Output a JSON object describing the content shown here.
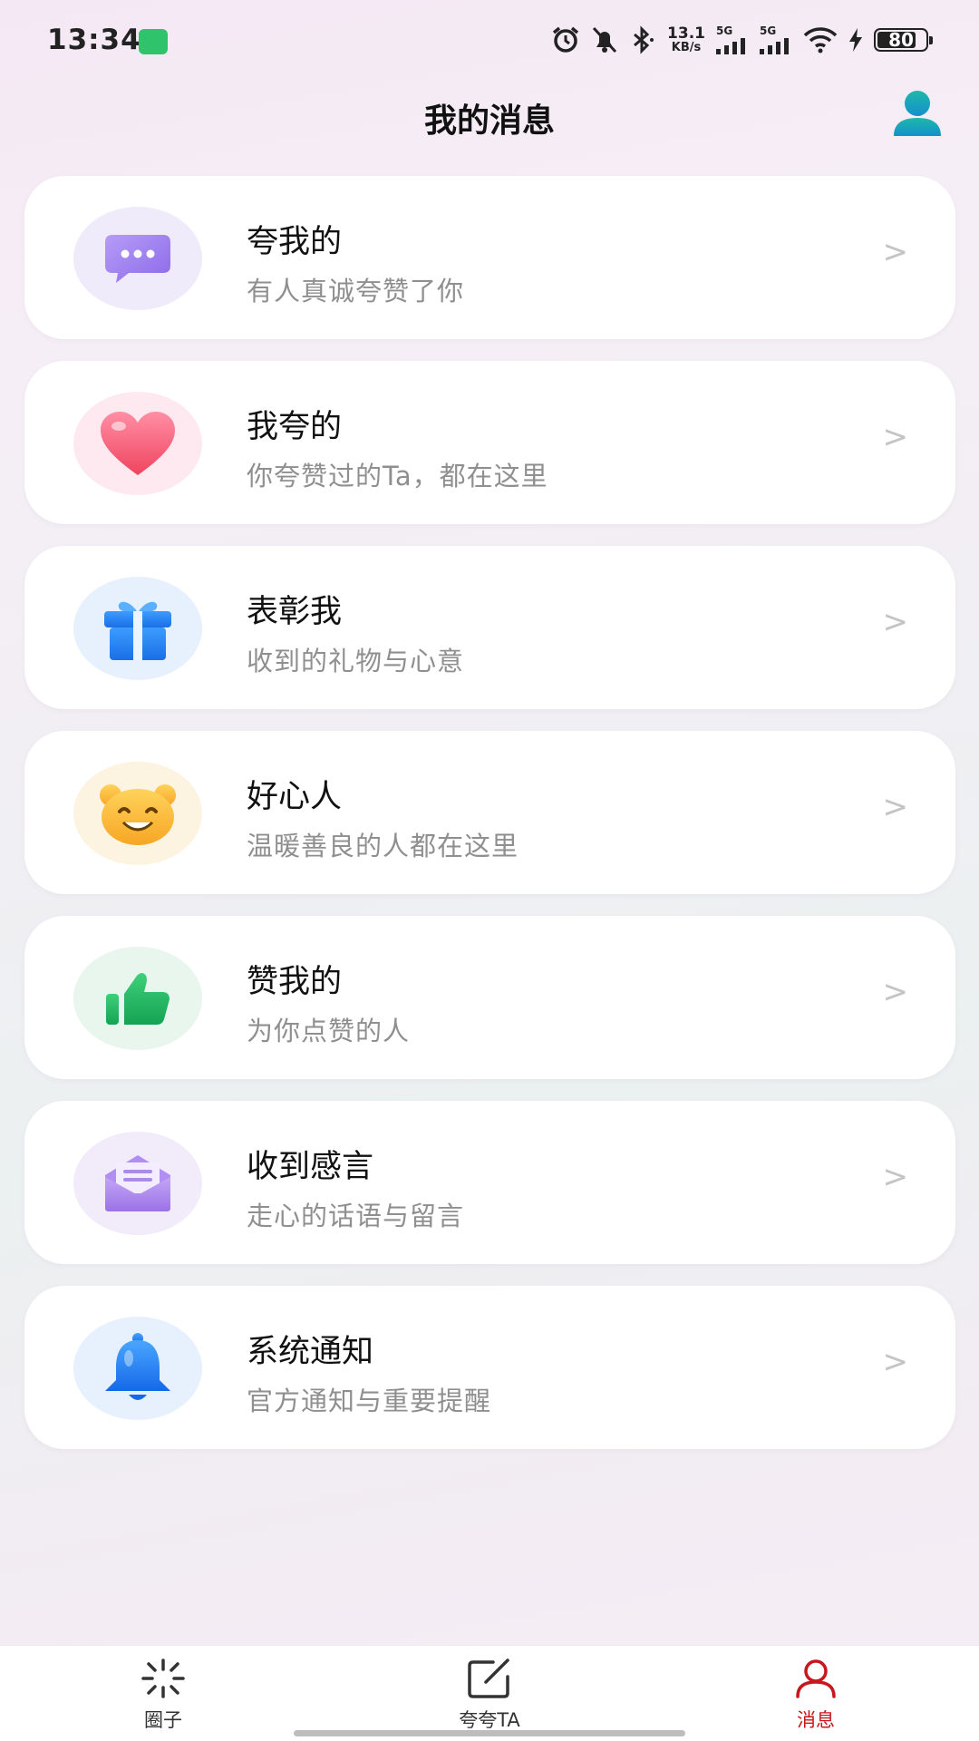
{
  "status_bar": {
    "time": "13:34",
    "net_speed_value": "13.1",
    "net_speed_unit": "KB/s",
    "signal1_label": "5G",
    "signal2_label": "5G",
    "battery": "80",
    "battery_level": 0.8
  },
  "header": {
    "title": "我的消息",
    "profile_icon": "user-silhouette-icon"
  },
  "items": [
    {
      "title": "夸我的",
      "subtitle": "有人真诚夸赞了你",
      "icon": "chat-bubble-icon",
      "bg": "#efebfb",
      "arrow": ">"
    },
    {
      "title": "我夸的",
      "subtitle": "你夸赞过的Ta，都在这里",
      "icon": "heart-icon",
      "bg": "#fde9ef",
      "arrow": ">"
    },
    {
      "title": "表彰我",
      "subtitle": "收到的礼物与心意",
      "icon": "gift-icon",
      "bg": "#e6f1fd",
      "arrow": ">"
    },
    {
      "title": "好心人",
      "subtitle": "温暖善良的人都在这里",
      "icon": "smiley-bear-icon",
      "bg": "#fdf3e1",
      "arrow": ">"
    },
    {
      "title": "赞我的",
      "subtitle": "为你点赞的人",
      "icon": "thumbs-up-icon",
      "bg": "#e8f6ee",
      "arrow": ">"
    },
    {
      "title": "收到感言",
      "subtitle": "走心的话语与留言",
      "icon": "envelope-icon",
      "bg": "#f1ebfa",
      "arrow": ">"
    },
    {
      "title": "系统通知",
      "subtitle": "官方通知与重要提醒",
      "icon": "bell-icon",
      "bg": "#e6f1fd",
      "arrow": ">"
    }
  ],
  "tabs": [
    {
      "label": "圈子",
      "icon": "sparkle-icon",
      "active": false
    },
    {
      "label": "夸夸TA",
      "icon": "edit-icon",
      "active": false
    },
    {
      "label": "消息",
      "icon": "person-icon",
      "active": true
    }
  ],
  "colors": {
    "active_tab": "#c9161d",
    "profile_icon": "#16a6c4"
  }
}
